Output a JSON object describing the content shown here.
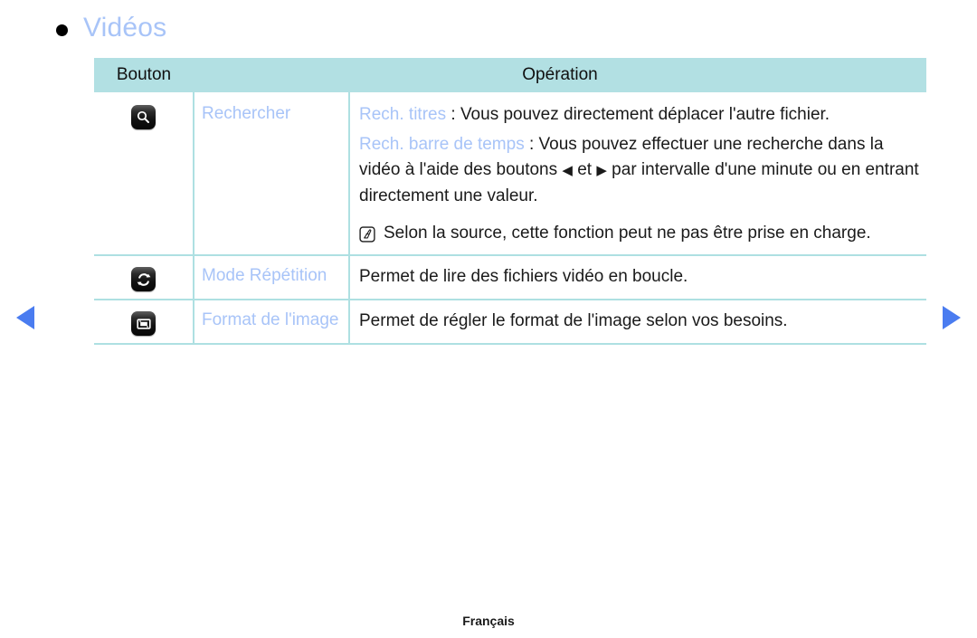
{
  "heading": {
    "bullet_icon": "bullet-dot-icon",
    "title": "Vidéos",
    "title_color": "#a8c4f8"
  },
  "table": {
    "columns": [
      "Bouton",
      "Opération"
    ],
    "header_background": "#b2e0e3",
    "border_color": "#aee0e2",
    "rows": [
      {
        "icon": "search-key-icon",
        "label": "Rechercher",
        "paragraphs": [
          {
            "key": "Rech. titres",
            "separator": " : ",
            "text": "Vous pouvez directement déplacer l'autre fichier."
          },
          {
            "key": "Rech. barre de temps",
            "separator": " : ",
            "text_before_arrows": "Vous pouvez effectuer une recherche dans la vidéo à l'aide des boutons ",
            "arrow_left": "◀",
            "arrow_conjunction": " et ",
            "arrow_right": "▶",
            "text_after_arrows": " par intervalle d'une minute ou en entrant directement une valeur."
          }
        ],
        "note": {
          "icon": "note-pen-icon",
          "text": "Selon la source, cette fonction peut ne pas être prise en charge."
        }
      },
      {
        "icon": "repeat-key-icon",
        "label": "Mode Répétition",
        "paragraphs": [
          {
            "text": "Permet de lire des fichiers vidéo en boucle."
          }
        ]
      },
      {
        "icon": "picture-size-key-icon",
        "label": "Format de l'image",
        "paragraphs": [
          {
            "text": "Permet de régler le format de l'image selon vos besoins."
          }
        ]
      }
    ]
  },
  "navigation": {
    "prev_icon": "triangle-left-icon",
    "next_icon": "triangle-right-icon",
    "arrow_color": "#4a7cf0"
  },
  "footer": {
    "language": "Français"
  }
}
